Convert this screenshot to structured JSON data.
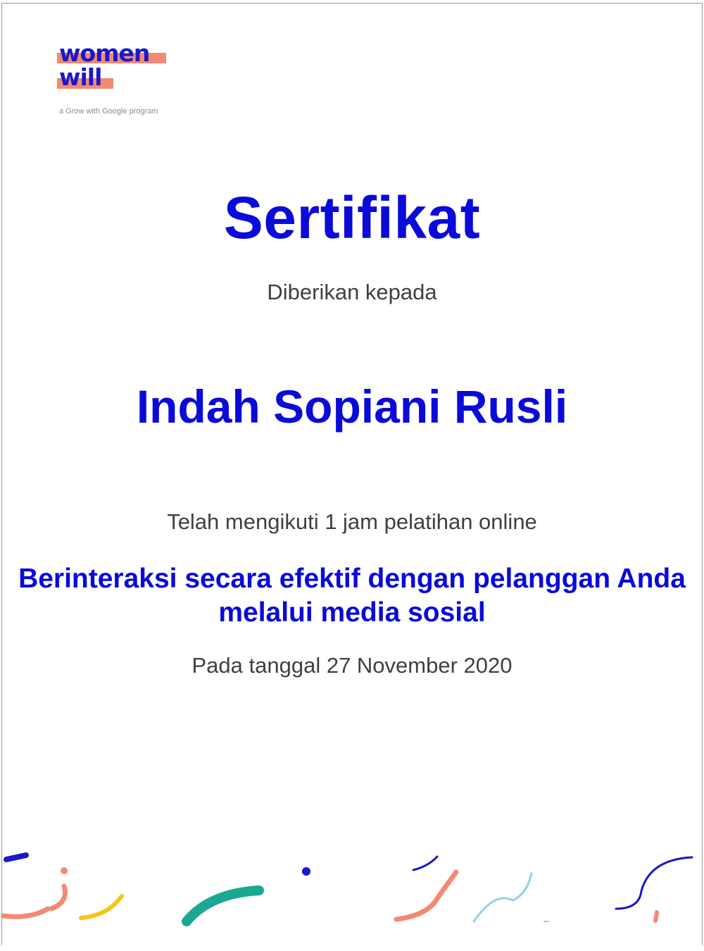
{
  "logo": {
    "line1": "women",
    "line2": "will",
    "tagline": "a Grow with Google program"
  },
  "certificate": {
    "title": "Sertifikat",
    "given_to_label": "Diberikan kepada",
    "recipient_name": "Indah Sopiani Rusli",
    "completion_text": "Telah mengikuti 1 jam pelatihan online",
    "course_title_line1": "Berinteraksi secara efektif dengan pelanggan Anda",
    "course_title_line2": "melalui media sosial",
    "date_text": "Pada tanggal 27 November 2020"
  },
  "colors": {
    "brand_blue": "#0a0ad9",
    "logo_coral": "#f28a73",
    "body_text": "#404040",
    "accent_teal": "#1aa893",
    "accent_yellow": "#f5c518",
    "accent_light_blue": "#8fd3e8"
  }
}
